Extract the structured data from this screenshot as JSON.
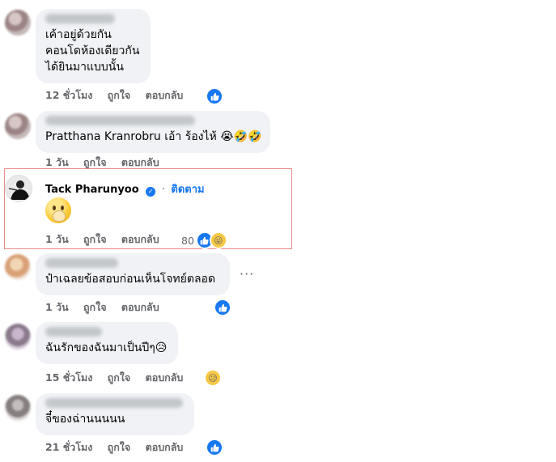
{
  "comments": [
    {
      "text_lines": [
        "เค้าอยู่ด้วยกัน",
        "คอนโดห้องเดียวกัน",
        "ได้ยินมาแบบนั้น"
      ],
      "time": "12 ชั่วโมง",
      "like": "ถูกใจ",
      "reply": "ตอบกลับ",
      "reaction": "like"
    },
    {
      "text": "Pratthana Kranrobru เอ้า ร้องไห้ 😭🤣🤣",
      "time": "1 วัน",
      "like": "ถูกใจ",
      "reply": "ตอบกลับ"
    },
    {
      "author": "Tack Pharunyoo",
      "verified_icon": "check",
      "separator": "·",
      "follow": "ติดตาม",
      "emoji": "face-with-hand-over-mouth",
      "time": "1 วัน",
      "like": "ถูกใจ",
      "reply": "ตอบกลับ",
      "reaction_count": "80",
      "reaction_icons": [
        "like",
        "😜"
      ]
    },
    {
      "text": "ป๋าเฉลยข้อสอบก่อนเห็นโจทย์ตลอด",
      "time": "1 วัน",
      "like": "ถูกใจ",
      "reply": "ตอบกลับ",
      "more": "···",
      "reaction": "like"
    },
    {
      "text": "ฉันรักของฉันมาเป็นปีๆ😥",
      "time": "15 ชั่วโมง",
      "like": "ถูกใจ",
      "reply": "ตอบกลับ",
      "reaction_emoji": "😥"
    },
    {
      "text": "จี๋ของฉ่านนนนน",
      "time": "21 ชั่วโมง",
      "like": "ถูกใจ",
      "reply": "ตอบกลับ",
      "reaction": "like"
    }
  ],
  "colors": {
    "accent": "#1877f2",
    "bubble": "#f0f2f5",
    "meta_text": "#65676b",
    "highlight_border": "#e88a8a"
  }
}
